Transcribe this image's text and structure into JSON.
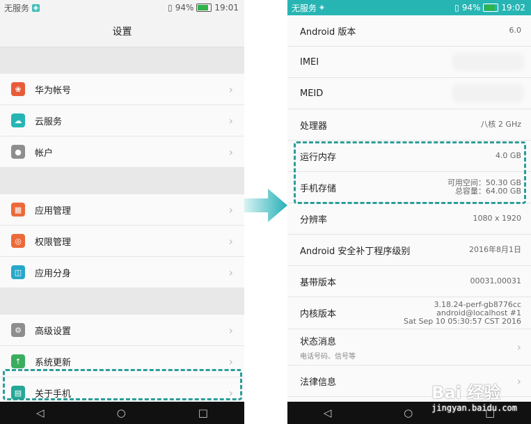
{
  "left": {
    "status": {
      "carrier": "无服务",
      "battery": "94%",
      "time": "19:01"
    },
    "title": "设置",
    "groups": [
      [
        {
          "label": "华为帐号",
          "icon": "huawei-icon",
          "color": "#e85c3a"
        },
        {
          "label": "云服务",
          "icon": "cloud-icon",
          "color": "#27b5b4"
        },
        {
          "label": "帐户",
          "icon": "account-icon",
          "color": "#8e8e8e"
        }
      ],
      [
        {
          "label": "应用管理",
          "icon": "apps-icon",
          "color": "#ec6a3a"
        },
        {
          "label": "权限管理",
          "icon": "permission-icon",
          "color": "#ec6a3a"
        },
        {
          "label": "应用分身",
          "icon": "clone-icon",
          "color": "#27a8c9"
        }
      ],
      [
        {
          "label": "高级设置",
          "icon": "gear-icon",
          "color": "#8e8e8e"
        },
        {
          "label": "系统更新",
          "icon": "update-icon",
          "color": "#3aae5e"
        },
        {
          "label": "关于手机",
          "icon": "phone-info-icon",
          "color": "#27a897"
        }
      ]
    ]
  },
  "right": {
    "status": {
      "carrier": "无服务",
      "battery": "94%",
      "time": "19:02"
    },
    "rows": {
      "android_version": {
        "label": "Android 版本",
        "value": "6.0"
      },
      "imei": {
        "label": "IMEI"
      },
      "meid": {
        "label": "MEID"
      },
      "cpu": {
        "label": "处理器",
        "value": "八核 2 GHz"
      },
      "ram": {
        "label": "运行内存",
        "value": "4.0 GB"
      },
      "storage": {
        "label": "手机存储",
        "value1": "可用空间：50.30  GB",
        "value2": "总容量：64.00  GB"
      },
      "resolution": {
        "label": "分辨率",
        "value": "1080 x 1920"
      },
      "patch": {
        "label": "Android 安全补丁程序级别",
        "value": "2016年8月1日"
      },
      "baseband": {
        "label": "基带版本",
        "value": "00031,00031"
      },
      "kernel": {
        "label": "内核版本",
        "value1": "3.18.24-perf-gb8776cc",
        "value2": "android@localhost #1",
        "value3": "Sat Sep 10 05:30:57 CST 2016"
      },
      "status_info": {
        "label": "状态消息",
        "sub": "电话号码、信号等"
      },
      "legal": {
        "label": "法律信息"
      }
    }
  },
  "watermark": {
    "brand": "Bai 经验",
    "url": "jingyan.baidu.com"
  }
}
